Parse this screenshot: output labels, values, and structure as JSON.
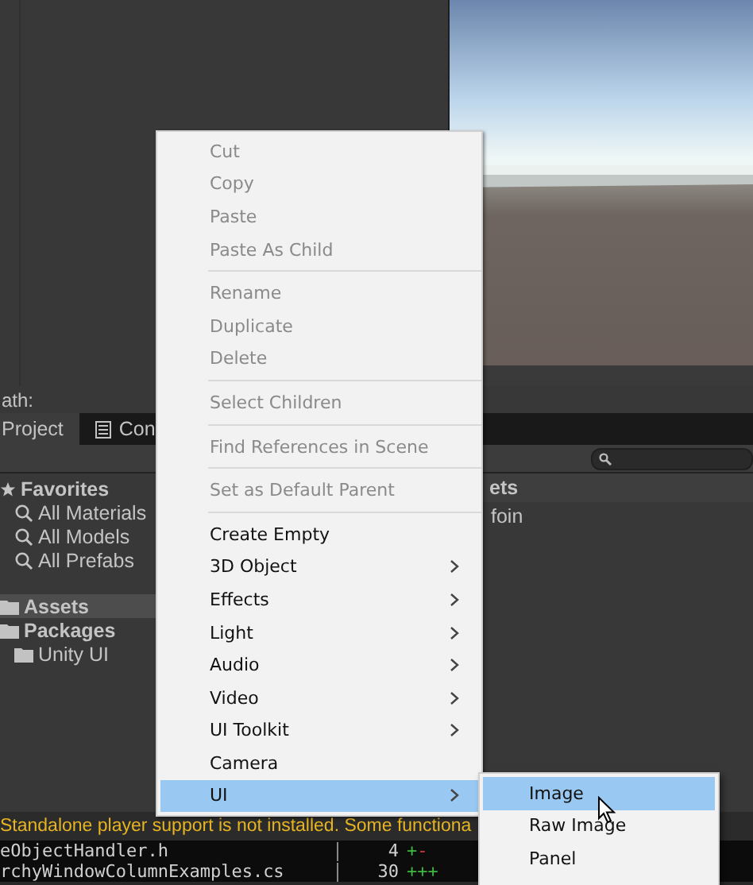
{
  "path_label": "ath:",
  "tabs": [
    {
      "label": "Project",
      "selected": true,
      "kind": "plain"
    },
    {
      "label": "Con",
      "selected": false,
      "kind": "console"
    }
  ],
  "tree": [
    {
      "label": "Favorites",
      "kind": "star",
      "selected": false,
      "children": [
        {
          "label": "All Materials",
          "kind": "search",
          "selected": false
        },
        {
          "label": "All Models",
          "kind": "search",
          "selected": false
        },
        {
          "label": "All Prefabs",
          "kind": "search",
          "selected": false
        }
      ]
    },
    {
      "label": "Assets",
      "kind": "folder",
      "selected": true
    },
    {
      "label": "Packages",
      "kind": "folder",
      "selected": false,
      "children": [
        {
          "label": "Unity UI",
          "kind": "folder",
          "selected": false
        }
      ]
    }
  ],
  "assets_panel": {
    "header": "ets",
    "items": [
      "foin"
    ]
  },
  "console_message": "Standalone player support is not installed. Some functiona",
  "terminal_lines": [
    {
      "file": "eObjectHandler.h",
      "count": "4",
      "added": "+",
      "removed": "-"
    },
    {
      "file": "rchyWindowColumnExamples.cs",
      "count": "30",
      "added": "+++"
    }
  ],
  "context_menu": {
    "groups": [
      [
        {
          "label": "Cut",
          "disabled": true,
          "submenu": false,
          "selected": false
        },
        {
          "label": "Copy",
          "disabled": true,
          "submenu": false,
          "selected": false
        },
        {
          "label": "Paste",
          "disabled": true,
          "submenu": false,
          "selected": false
        },
        {
          "label": "Paste As Child",
          "disabled": true,
          "submenu": false,
          "selected": false
        }
      ],
      [
        {
          "label": "Rename",
          "disabled": true,
          "submenu": false,
          "selected": false
        },
        {
          "label": "Duplicate",
          "disabled": true,
          "submenu": false,
          "selected": false
        },
        {
          "label": "Delete",
          "disabled": true,
          "submenu": false,
          "selected": false
        }
      ],
      [
        {
          "label": "Select Children",
          "disabled": true,
          "submenu": false,
          "selected": false
        }
      ],
      [
        {
          "label": "Find References in Scene",
          "disabled": true,
          "submenu": false,
          "selected": false
        }
      ],
      [
        {
          "label": "Set as Default Parent",
          "disabled": true,
          "submenu": false,
          "selected": false
        }
      ],
      [
        {
          "label": "Create Empty",
          "disabled": false,
          "submenu": false,
          "selected": false
        },
        {
          "label": "3D Object",
          "disabled": false,
          "submenu": true,
          "selected": false
        },
        {
          "label": "Effects",
          "disabled": false,
          "submenu": true,
          "selected": false
        },
        {
          "label": "Light",
          "disabled": false,
          "submenu": true,
          "selected": false
        },
        {
          "label": "Audio",
          "disabled": false,
          "submenu": true,
          "selected": false
        },
        {
          "label": "Video",
          "disabled": false,
          "submenu": true,
          "selected": false
        },
        {
          "label": "UI Toolkit",
          "disabled": false,
          "submenu": true,
          "selected": false
        },
        {
          "label": "Camera",
          "disabled": false,
          "submenu": false,
          "selected": false
        },
        {
          "label": "UI",
          "disabled": false,
          "submenu": true,
          "selected": true
        }
      ]
    ]
  },
  "submenu": {
    "items": [
      {
        "label": "Image",
        "selected": true
      },
      {
        "label": "Raw Image",
        "selected": false
      },
      {
        "label": "Panel",
        "selected": false
      }
    ]
  }
}
